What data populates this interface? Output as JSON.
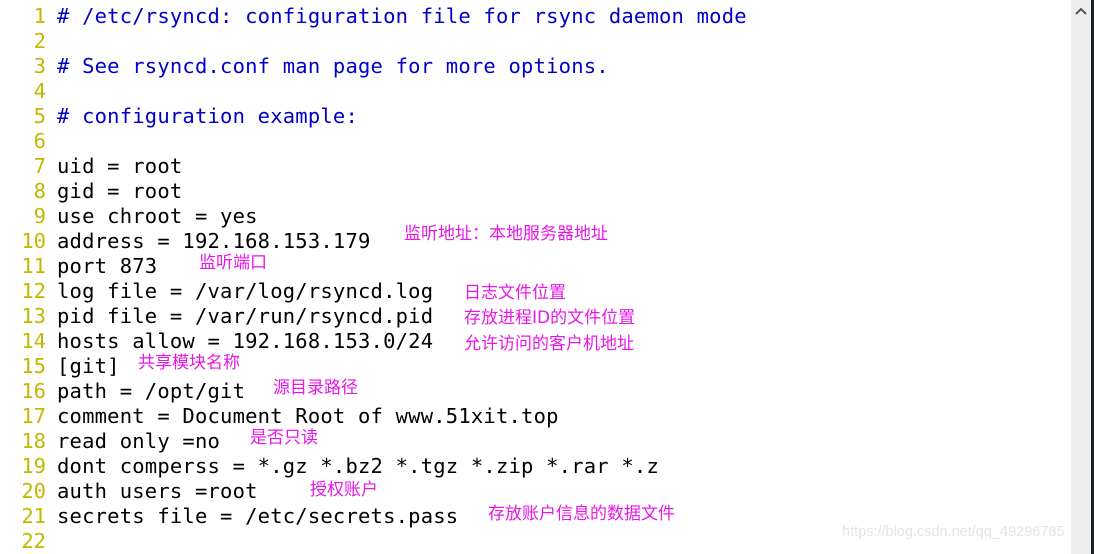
{
  "editor": {
    "lines": [
      {
        "num": "1",
        "text": "# /etc/rsyncd: configuration file for rsync daemon mode",
        "type": "comment"
      },
      {
        "num": "2",
        "text": "",
        "type": "code"
      },
      {
        "num": "3",
        "text": "# See rsyncd.conf man page for more options.",
        "type": "comment"
      },
      {
        "num": "4",
        "text": "",
        "type": "code"
      },
      {
        "num": "5",
        "text": "# configuration example:",
        "type": "comment"
      },
      {
        "num": "6",
        "text": "",
        "type": "code"
      },
      {
        "num": "7",
        "text": "uid = root",
        "type": "code"
      },
      {
        "num": "8",
        "text": "gid = root",
        "type": "code"
      },
      {
        "num": "9",
        "text": "use chroot = yes",
        "type": "code"
      },
      {
        "num": "10",
        "text": "address = 192.168.153.179",
        "type": "code"
      },
      {
        "num": "11",
        "text": "port 873",
        "type": "code"
      },
      {
        "num": "12",
        "text": "log file = /var/log/rsyncd.log",
        "type": "code"
      },
      {
        "num": "13",
        "text": "pid file = /var/run/rsyncd.pid",
        "type": "code"
      },
      {
        "num": "14",
        "text": "hosts allow = 192.168.153.0/24",
        "type": "code"
      },
      {
        "num": "15",
        "text": "[git]",
        "type": "code"
      },
      {
        "num": "16",
        "text": "path = /opt/git",
        "type": "code"
      },
      {
        "num": "17",
        "text": "comment = Document Root of www.51xit.top",
        "type": "code"
      },
      {
        "num": "18",
        "text": "read only =no",
        "type": "code"
      },
      {
        "num": "19",
        "text": "dont comperss = *.gz *.bz2 *.tgz *.zip *.rar *.z",
        "type": "code"
      },
      {
        "num": "20",
        "text": "auth users =root",
        "type": "code"
      },
      {
        "num": "21",
        "text": "secrets file = /etc/secrets.pass",
        "type": "code"
      },
      {
        "num": "22",
        "text": "",
        "type": "code"
      }
    ]
  },
  "annotations": [
    {
      "line": "10",
      "text": "监听地址：本地服务器地址"
    },
    {
      "line": "11",
      "text": "监听端口"
    },
    {
      "line": "12",
      "text": "日志文件位置"
    },
    {
      "line": "13",
      "text": "存放进程ID的文件位置"
    },
    {
      "line": "14",
      "text": "允许访问的客户机地址"
    },
    {
      "line": "15",
      "text": "共享模块名称"
    },
    {
      "line": "16",
      "text": "源目录路径"
    },
    {
      "line": "18",
      "text": "是否只读"
    },
    {
      "line": "20",
      "text": "授权账户"
    },
    {
      "line": "21",
      "text": "存放账户信息的数据文件"
    }
  ],
  "colors": {
    "line_number": "#c2b800",
    "comment": "#0000c8",
    "code": "#000000",
    "annotation": "#e817e8"
  },
  "scrollbar": {
    "up_icon": "chevron-up-icon"
  },
  "watermark": "https://blog.csdn.net/qq_49296785"
}
